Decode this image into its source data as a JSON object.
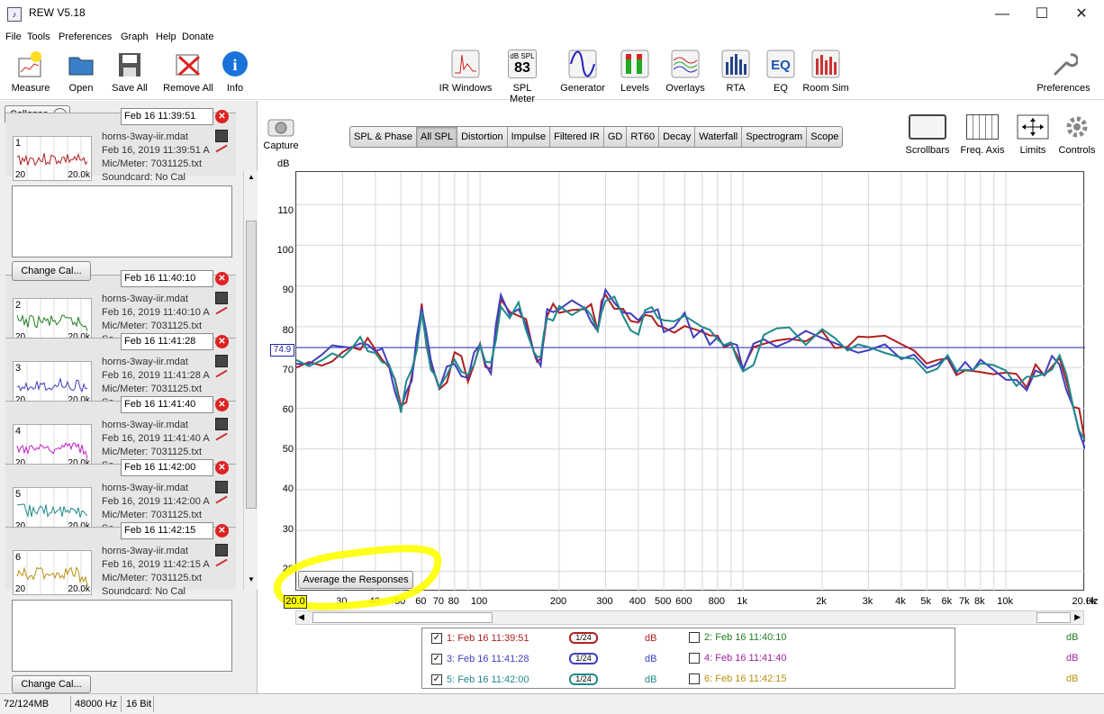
{
  "window": {
    "title": "REW V5.18",
    "minimize": "—",
    "maximize": "☐",
    "close": "✕"
  },
  "menu": [
    "File",
    "Tools",
    "Preferences",
    "Graph",
    "Help",
    "Donate"
  ],
  "toolbar": {
    "left": [
      "Measure",
      "Open",
      "Save All",
      "Remove All",
      "Info"
    ],
    "center": [
      "IR Windows",
      "SPL Meter",
      "Generator",
      "Levels",
      "Overlays",
      "RTA",
      "EQ",
      "Room Sim"
    ],
    "spl_meter_unit": "dB SPL",
    "spl_meter_value": "83",
    "right": "Preferences"
  },
  "panel": {
    "collapse": "Collapse",
    "change_cal": "Change Cal...",
    "measurements": [
      {
        "num": "1",
        "date": "Feb 16 11:39:51",
        "file": "horns-3way-iir.mdat",
        "datetime": "Feb 16, 2019 11:39:51 A",
        "mic": "Mic/Meter: 7031125.txt",
        "soundcard": "Soundcard: No Cal",
        "color": "#b02020"
      },
      {
        "num": "2",
        "date": "Feb 16 11:40:10",
        "file": "horns-3way-iir.mdat",
        "datetime": "Feb 16, 2019 11:40:10 A",
        "mic": "Mic/Meter: 7031125.txt",
        "soundcard": "So",
        "color": "#208020"
      },
      {
        "num": "3",
        "date": "Feb 16 11:41:28",
        "file": "horns-3way-iir.mdat",
        "datetime": "Feb 16, 2019 11:41:28 A",
        "mic": "Mic/Meter: 7031125.txt",
        "soundcard": "Se",
        "color": "#4040c0"
      },
      {
        "num": "4",
        "date": "Feb 16 11:41:40",
        "file": "horns-3way-iir.mdat",
        "datetime": "Feb 16, 2019 11:41:40 A",
        "mic": "Mic/Meter: 7031125.txt",
        "soundcard": "Se",
        "color": "#c020c0"
      },
      {
        "num": "5",
        "date": "Feb 16 11:42:00",
        "file": "horns-3way-iir.mdat",
        "datetime": "Feb 16, 2019 11:42:00 A",
        "mic": "Mic/Meter: 7031125.txt",
        "soundcard": "Se",
        "color": "#208a8a"
      },
      {
        "num": "6",
        "date": "Feb 16 11:42:15",
        "file": "horns-3way-iir.mdat",
        "datetime": "Feb 16, 2019 11:42:15 A",
        "mic": "Mic/Meter: 7031125.txt",
        "soundcard": "Soundcard: No Cal",
        "color": "#b89010"
      }
    ],
    "thumb_min": "20",
    "thumb_max": "20.0k"
  },
  "capture": "Capture",
  "tabs": [
    "SPL & Phase",
    "All SPL",
    "Distortion",
    "Impulse",
    "Filtered IR",
    "GD",
    "RT60",
    "Decay",
    "Waterfall",
    "Spectrogram",
    "Scope"
  ],
  "active_tab": "All SPL",
  "graph_tools": [
    "Scrollbars",
    "Freq. Axis",
    "Limits",
    "Controls"
  ],
  "graph": {
    "y_unit": "dB",
    "y_ticks": [
      "110",
      "100",
      "90",
      "80",
      "70",
      "60",
      "50",
      "40",
      "30",
      "20"
    ],
    "x_ticks": [
      "20.0",
      "30",
      "40",
      "50",
      "60",
      "70",
      "80",
      "100",
      "200",
      "300",
      "400",
      "500",
      "600",
      "800",
      "1k",
      "2k",
      "3k",
      "4k",
      "5k",
      "6k",
      "7k",
      "8k",
      "10k",
      "20.0k"
    ],
    "x_unit": "Hz",
    "cursor_value": "74.9",
    "average_button": "Average the Responses"
  },
  "legend": [
    {
      "label": "1: Feb 16 11:39:51",
      "checked": true,
      "smoothing": "1/24",
      "unit": "dB",
      "color": "#b02020"
    },
    {
      "label": "2: Feb 16 11:40:10",
      "checked": false,
      "smoothing": "",
      "unit": "dB",
      "color": "#208020"
    },
    {
      "label": "3: Feb 16 11:41:28",
      "checked": true,
      "smoothing": "1/24",
      "unit": "dB",
      "color": "#4040c0"
    },
    {
      "label": "4: Feb 16 11:41:40",
      "checked": false,
      "smoothing": "",
      "unit": "dB",
      "color": "#a020a0"
    },
    {
      "label": "5: Feb 16 11:42:00",
      "checked": true,
      "smoothing": "1/24",
      "unit": "dB",
      "color": "#208a8a"
    },
    {
      "label": "6: Feb 16 11:42:15",
      "checked": false,
      "smoothing": "",
      "unit": "dB",
      "color": "#b89010"
    }
  ],
  "status": {
    "memory": "72/124MB",
    "rate": "48000 Hz",
    "bits": "16 Bit"
  }
}
